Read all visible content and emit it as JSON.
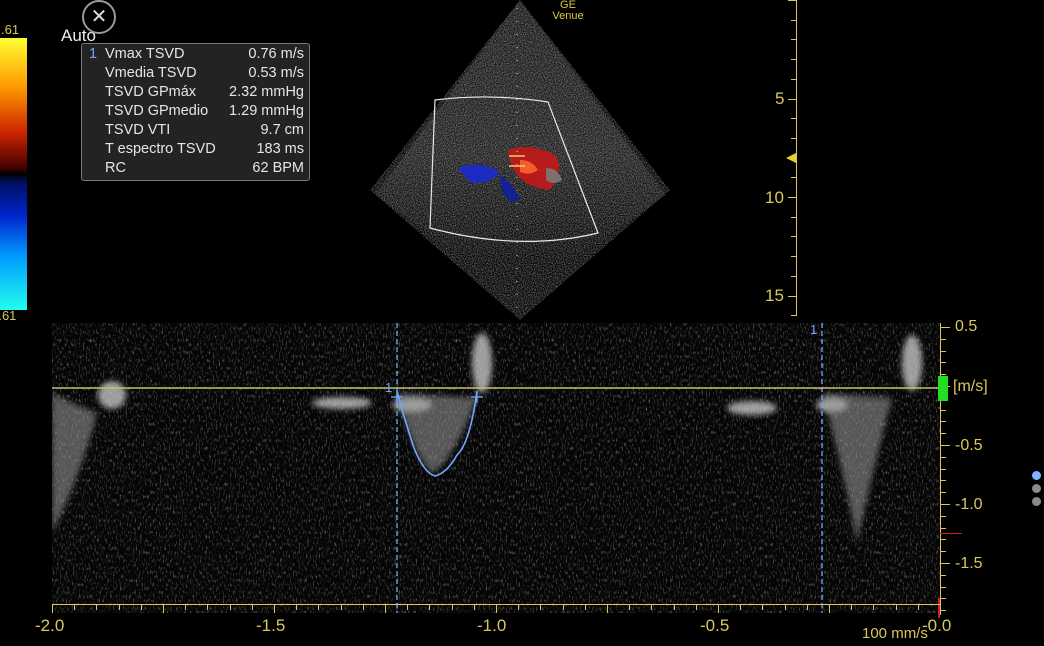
{
  "colorbar": {
    "top_label": ".61",
    "bottom_label": "-.61"
  },
  "mode_label": "Auto",
  "close_icon": "close-icon",
  "probe": {
    "line1": "GE",
    "line2": "Venue"
  },
  "measurements": [
    {
      "index": "1",
      "label": "Vmax TSVD",
      "value": "0.76 m/s"
    },
    {
      "index": "",
      "label": "Vmedia TSVD",
      "value": "0.53 m/s"
    },
    {
      "index": "",
      "label": "TSVD GPmáx",
      "value": "2.32 mmHg"
    },
    {
      "index": "",
      "label": "TSVD GPmedio",
      "value": "1.29 mmHg"
    },
    {
      "index": "",
      "label": "TSVD VTI",
      "value": "9.7 cm"
    },
    {
      "index": "",
      "label": "T espectro TSVD",
      "value": "183 ms"
    },
    {
      "index": "",
      "label": "RC",
      "value": "62 BPM"
    }
  ],
  "depth_scale": {
    "labels": [
      "5",
      "10",
      "15"
    ]
  },
  "velocity_scale": {
    "labels": [
      "0.5",
      "-0.5",
      "-1.0",
      "-1.5"
    ],
    "unit": "[m/s]"
  },
  "time_axis": {
    "labels": [
      "-2.0",
      "-1.5",
      "-1.0",
      "-0.5",
      "-0.0"
    ]
  },
  "sweep_speed": "100 mm/s",
  "caliper_labels": {
    "left": "1",
    "right": "1",
    "trace": "1"
  },
  "colors": {
    "accent_yellow": "#d8c85a",
    "trace_blue": "#6fa8ff",
    "baseline_marker": "#22dd22"
  },
  "page_indicator": {
    "count": 3,
    "active": 1
  }
}
